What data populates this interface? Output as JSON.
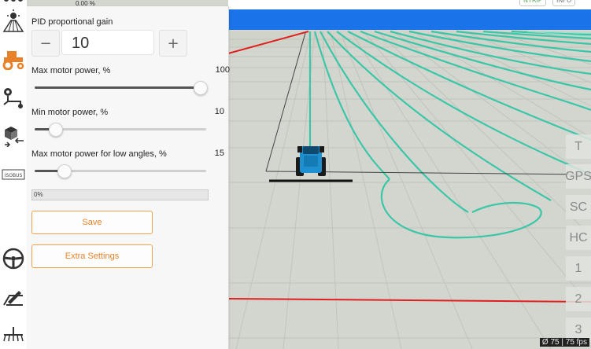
{
  "top": {
    "pct": "0.00 %",
    "pill_left": "NTRIP",
    "pill_right": "INFO"
  },
  "panel": {
    "gain": {
      "label": "PID proportional gain",
      "value": "10",
      "minus": "−",
      "plus": "+"
    },
    "sliders": [
      {
        "label": "Max motor power, %",
        "value": "100",
        "level": 100
      },
      {
        "label": "Min motor power, %",
        "value": "10",
        "level": 10
      },
      {
        "label": "Max motor power for low angles, %",
        "value": "15",
        "level": 15
      }
    ],
    "progress": {
      "text": "0%",
      "level": 0
    },
    "save_label": "Save",
    "extra_label": "Extra Settings"
  },
  "left_tools": [
    "sun-field-icon",
    "tractor-icon",
    "route-icon",
    "box-transfer-icon",
    "gps-box-icon",
    "steering-wheel-icon",
    "field-edit-icon",
    "implement-icon"
  ],
  "right_buttons": [
    "T",
    "GPS",
    "SC",
    "HC",
    "1",
    "2",
    "3"
  ],
  "fps": "Ø 75 | 75 fps",
  "colors": {
    "guidance": "#3cc6a8",
    "boundary": "#e02020",
    "accent": "#e8822a",
    "tractor": "#1e90d0"
  }
}
